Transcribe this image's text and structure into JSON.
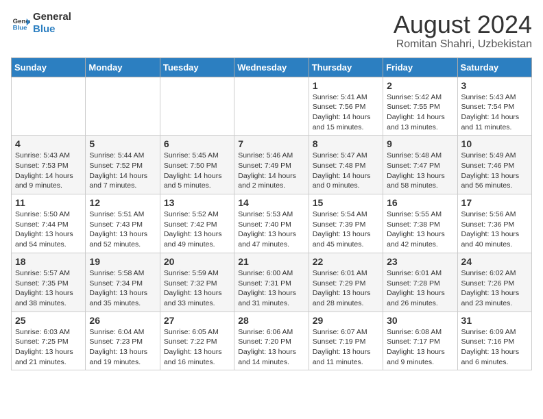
{
  "header": {
    "logo_line1": "General",
    "logo_line2": "Blue",
    "month_title": "August 2024",
    "subtitle": "Romitan Shahri, Uzbekistan"
  },
  "calendar": {
    "days_of_week": [
      "Sunday",
      "Monday",
      "Tuesday",
      "Wednesday",
      "Thursday",
      "Friday",
      "Saturday"
    ],
    "weeks": [
      [
        {
          "day": "",
          "info": ""
        },
        {
          "day": "",
          "info": ""
        },
        {
          "day": "",
          "info": ""
        },
        {
          "day": "",
          "info": ""
        },
        {
          "day": "1",
          "info": "Sunrise: 5:41 AM\nSunset: 7:56 PM\nDaylight: 14 hours\nand 15 minutes."
        },
        {
          "day": "2",
          "info": "Sunrise: 5:42 AM\nSunset: 7:55 PM\nDaylight: 14 hours\nand 13 minutes."
        },
        {
          "day": "3",
          "info": "Sunrise: 5:43 AM\nSunset: 7:54 PM\nDaylight: 14 hours\nand 11 minutes."
        }
      ],
      [
        {
          "day": "4",
          "info": "Sunrise: 5:43 AM\nSunset: 7:53 PM\nDaylight: 14 hours\nand 9 minutes."
        },
        {
          "day": "5",
          "info": "Sunrise: 5:44 AM\nSunset: 7:52 PM\nDaylight: 14 hours\nand 7 minutes."
        },
        {
          "day": "6",
          "info": "Sunrise: 5:45 AM\nSunset: 7:50 PM\nDaylight: 14 hours\nand 5 minutes."
        },
        {
          "day": "7",
          "info": "Sunrise: 5:46 AM\nSunset: 7:49 PM\nDaylight: 14 hours\nand 2 minutes."
        },
        {
          "day": "8",
          "info": "Sunrise: 5:47 AM\nSunset: 7:48 PM\nDaylight: 14 hours\nand 0 minutes."
        },
        {
          "day": "9",
          "info": "Sunrise: 5:48 AM\nSunset: 7:47 PM\nDaylight: 13 hours\nand 58 minutes."
        },
        {
          "day": "10",
          "info": "Sunrise: 5:49 AM\nSunset: 7:46 PM\nDaylight: 13 hours\nand 56 minutes."
        }
      ],
      [
        {
          "day": "11",
          "info": "Sunrise: 5:50 AM\nSunset: 7:44 PM\nDaylight: 13 hours\nand 54 minutes."
        },
        {
          "day": "12",
          "info": "Sunrise: 5:51 AM\nSunset: 7:43 PM\nDaylight: 13 hours\nand 52 minutes."
        },
        {
          "day": "13",
          "info": "Sunrise: 5:52 AM\nSunset: 7:42 PM\nDaylight: 13 hours\nand 49 minutes."
        },
        {
          "day": "14",
          "info": "Sunrise: 5:53 AM\nSunset: 7:40 PM\nDaylight: 13 hours\nand 47 minutes."
        },
        {
          "day": "15",
          "info": "Sunrise: 5:54 AM\nSunset: 7:39 PM\nDaylight: 13 hours\nand 45 minutes."
        },
        {
          "day": "16",
          "info": "Sunrise: 5:55 AM\nSunset: 7:38 PM\nDaylight: 13 hours\nand 42 minutes."
        },
        {
          "day": "17",
          "info": "Sunrise: 5:56 AM\nSunset: 7:36 PM\nDaylight: 13 hours\nand 40 minutes."
        }
      ],
      [
        {
          "day": "18",
          "info": "Sunrise: 5:57 AM\nSunset: 7:35 PM\nDaylight: 13 hours\nand 38 minutes."
        },
        {
          "day": "19",
          "info": "Sunrise: 5:58 AM\nSunset: 7:34 PM\nDaylight: 13 hours\nand 35 minutes."
        },
        {
          "day": "20",
          "info": "Sunrise: 5:59 AM\nSunset: 7:32 PM\nDaylight: 13 hours\nand 33 minutes."
        },
        {
          "day": "21",
          "info": "Sunrise: 6:00 AM\nSunset: 7:31 PM\nDaylight: 13 hours\nand 31 minutes."
        },
        {
          "day": "22",
          "info": "Sunrise: 6:01 AM\nSunset: 7:29 PM\nDaylight: 13 hours\nand 28 minutes."
        },
        {
          "day": "23",
          "info": "Sunrise: 6:01 AM\nSunset: 7:28 PM\nDaylight: 13 hours\nand 26 minutes."
        },
        {
          "day": "24",
          "info": "Sunrise: 6:02 AM\nSunset: 7:26 PM\nDaylight: 13 hours\nand 23 minutes."
        }
      ],
      [
        {
          "day": "25",
          "info": "Sunrise: 6:03 AM\nSunset: 7:25 PM\nDaylight: 13 hours\nand 21 minutes."
        },
        {
          "day": "26",
          "info": "Sunrise: 6:04 AM\nSunset: 7:23 PM\nDaylight: 13 hours\nand 19 minutes."
        },
        {
          "day": "27",
          "info": "Sunrise: 6:05 AM\nSunset: 7:22 PM\nDaylight: 13 hours\nand 16 minutes."
        },
        {
          "day": "28",
          "info": "Sunrise: 6:06 AM\nSunset: 7:20 PM\nDaylight: 13 hours\nand 14 minutes."
        },
        {
          "day": "29",
          "info": "Sunrise: 6:07 AM\nSunset: 7:19 PM\nDaylight: 13 hours\nand 11 minutes."
        },
        {
          "day": "30",
          "info": "Sunrise: 6:08 AM\nSunset: 7:17 PM\nDaylight: 13 hours\nand 9 minutes."
        },
        {
          "day": "31",
          "info": "Sunrise: 6:09 AM\nSunset: 7:16 PM\nDaylight: 13 hours\nand 6 minutes."
        }
      ]
    ]
  }
}
